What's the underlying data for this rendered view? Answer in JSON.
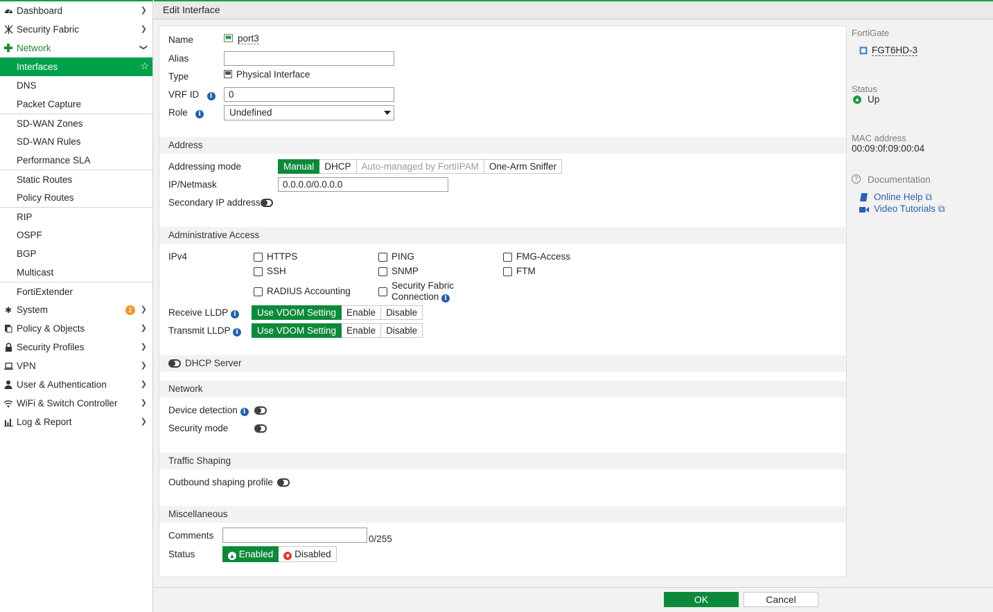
{
  "sidebar": {
    "top": [
      {
        "label": "Dashboard",
        "icon": "dashboard-icon"
      },
      {
        "label": "Security Fabric",
        "icon": "security-fabric-icon"
      },
      {
        "label": "Network",
        "icon": "network-icon"
      }
    ],
    "network_items": [
      "Interfaces",
      "DNS",
      "Packet Capture",
      "SD-WAN Zones",
      "SD-WAN Rules",
      "Performance SLA",
      "Static Routes",
      "Policy Routes",
      "RIP",
      "OSPF",
      "BGP",
      "Multicast",
      "FortiExtender"
    ],
    "bottom": [
      {
        "label": "System",
        "icon": "gear-icon",
        "badge": "2"
      },
      {
        "label": "Policy & Objects",
        "icon": "policy-icon"
      },
      {
        "label": "Security Profiles",
        "icon": "lock-icon"
      },
      {
        "label": "VPN",
        "icon": "laptop-icon"
      },
      {
        "label": "User & Authentication",
        "icon": "user-icon"
      },
      {
        "label": "WiFi & Switch Controller",
        "icon": "wifi-icon"
      },
      {
        "label": "Log & Report",
        "icon": "bar-chart-icon"
      }
    ]
  },
  "header": {
    "title": "Edit Interface"
  },
  "form": {
    "name_label": "Name",
    "name_value": "port3",
    "alias_label": "Alias",
    "alias_value": "",
    "type_label": "Type",
    "type_value": "Physical Interface",
    "vrf_label": "VRF ID",
    "vrf_value": "0",
    "role_label": "Role",
    "role_value": "Undefined",
    "address_section": "Address",
    "addressing_mode_label": "Addressing mode",
    "addressing_modes": [
      "Manual",
      "DHCP",
      "Auto-managed by FortiIPAM",
      "One-Arm Sniffer"
    ],
    "ip_label": "IP/Netmask",
    "ip_value": "0.0.0.0/0.0.0.0",
    "secondary_ip_label": "Secondary IP address",
    "admin_section": "Administrative Access",
    "ipv4_label": "IPv4",
    "access": {
      "https": "HTTPS",
      "ping": "PING",
      "fmg": "FMG-Access",
      "ssh": "SSH",
      "snmp": "SNMP",
      "ftm": "FTM",
      "radius": "RADIUS Accounting",
      "fabric_line1": "Security Fabric",
      "fabric_line2": "Connection"
    },
    "receive_lldp_label": "Receive LLDP",
    "transmit_lldp_label": "Transmit LLDP",
    "lldp_options": [
      "Use VDOM Setting",
      "Enable",
      "Disable"
    ],
    "dhcp_server_label": "DHCP Server",
    "network_section": "Network",
    "device_detection_label": "Device detection",
    "security_mode_label": "Security mode",
    "traffic_section": "Traffic Shaping",
    "outbound_label": "Outbound shaping profile",
    "misc_section": "Miscellaneous",
    "comments_label": "Comments",
    "comments_value": "",
    "comments_count": "0/255",
    "status_label": "Status",
    "status_enabled": "Enabled",
    "status_disabled": "Disabled"
  },
  "info_panel": {
    "fortigate_label": "FortiGate",
    "fortigate_value": "FGT6HD-3",
    "status_label": "Status",
    "status_value": "Up",
    "mac_label": "MAC address",
    "mac_value": "00:09:0f:09:00:04",
    "doc_label": "Documentation",
    "online_help": "Online Help",
    "video_tutorials": "Video Tutorials"
  },
  "footer": {
    "ok": "OK",
    "cancel": "Cancel"
  },
  "colors": {
    "accent": "#00a14b",
    "button_green": "#0c8a3a",
    "link": "#2862b3",
    "highlight": "#ffff44",
    "badge": "#e99a2c"
  }
}
